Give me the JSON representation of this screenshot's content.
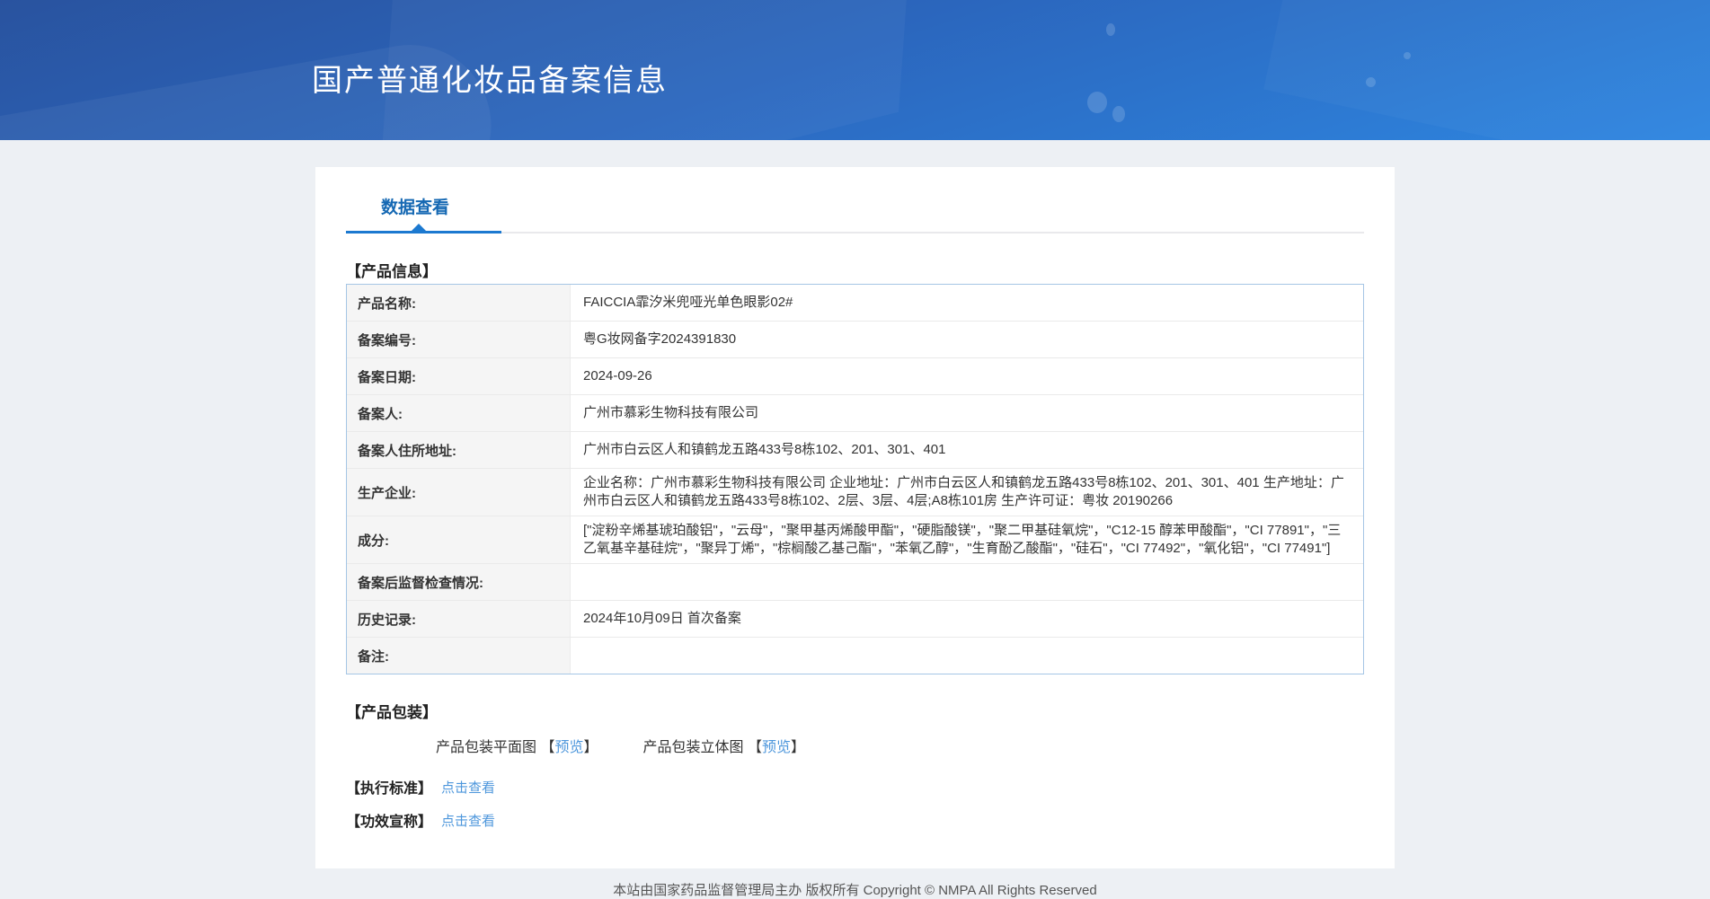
{
  "page": {
    "title": "国产普通化妆品备案信息",
    "tab": "数据查看",
    "footer": "本站由国家药品监督管理局主办 版权所有 Copyright © NMPA All Rights Reserved"
  },
  "product_info": {
    "section_title": "【产品信息】",
    "rows": [
      {
        "label": "产品名称:",
        "value": "FAICCIA霏汐米兜哑光单色眼影02#"
      },
      {
        "label": "备案编号:",
        "value": "粤G妆网备字2024391830"
      },
      {
        "label": "备案日期:",
        "value": "2024-09-26"
      },
      {
        "label": "备案人:",
        "value": "广州市慕彩生物科技有限公司"
      },
      {
        "label": "备案人住所地址:",
        "value": "广州市白云区人和镇鹤龙五路433号8栋102、201、301、401"
      },
      {
        "label": "生产企业:",
        "value": "企业名称：广州市慕彩生物科技有限公司 企业地址：广州市白云区人和镇鹤龙五路433号8栋102、201、301、401 生产地址：广州市白云区人和镇鹤龙五路433号8栋102、2层、3层、4层;A8栋101房 生产许可证：粤妆 20190266"
      },
      {
        "label": "成分:",
        "value": "[\"淀粉辛烯基琥珀酸铝\"，\"云母\"，\"聚甲基丙烯酸甲酯\"，\"硬脂酸镁\"，\"聚二甲基硅氧烷\"，\"C12-15 醇苯甲酸酯\"，\"CI 77891\"，\"三乙氧基辛基硅烷\"，\"聚异丁烯\"，\"棕榈酸乙基己酯\"，\"苯氧乙醇\"，\"生育酚乙酸酯\"，\"硅石\"，\"CI 77492\"，\"氧化铝\"，\"CI 77491\"]"
      },
      {
        "label": "备案后监督检查情况:",
        "value": ""
      },
      {
        "label": "历史记录:",
        "value": "2024年10月09日 首次备案"
      },
      {
        "label": "备注:",
        "value": ""
      }
    ]
  },
  "packaging": {
    "section_title": "【产品包装】",
    "flat_label": "产品包装平面图",
    "stereo_label": "产品包装立体图",
    "bracket_open": "【",
    "bracket_close": "】",
    "preview_label": "预览"
  },
  "exec_standard": {
    "section_title": "【执行标准】",
    "link": "点击查看"
  },
  "efficacy": {
    "section_title": "【功效宣称】",
    "link": "点击查看"
  },
  "colors": {
    "header_gradient_start": "#29539f",
    "header_gradient_end": "#2e86e0",
    "tab_blue": "#1568b3",
    "underline_blue": "#1c79d0",
    "link_blue": "#4e97dc",
    "table_border_blue": "#a5c6e5",
    "label_cell_bg": "#f5f5f5",
    "page_bg": "#edf0f4"
  }
}
